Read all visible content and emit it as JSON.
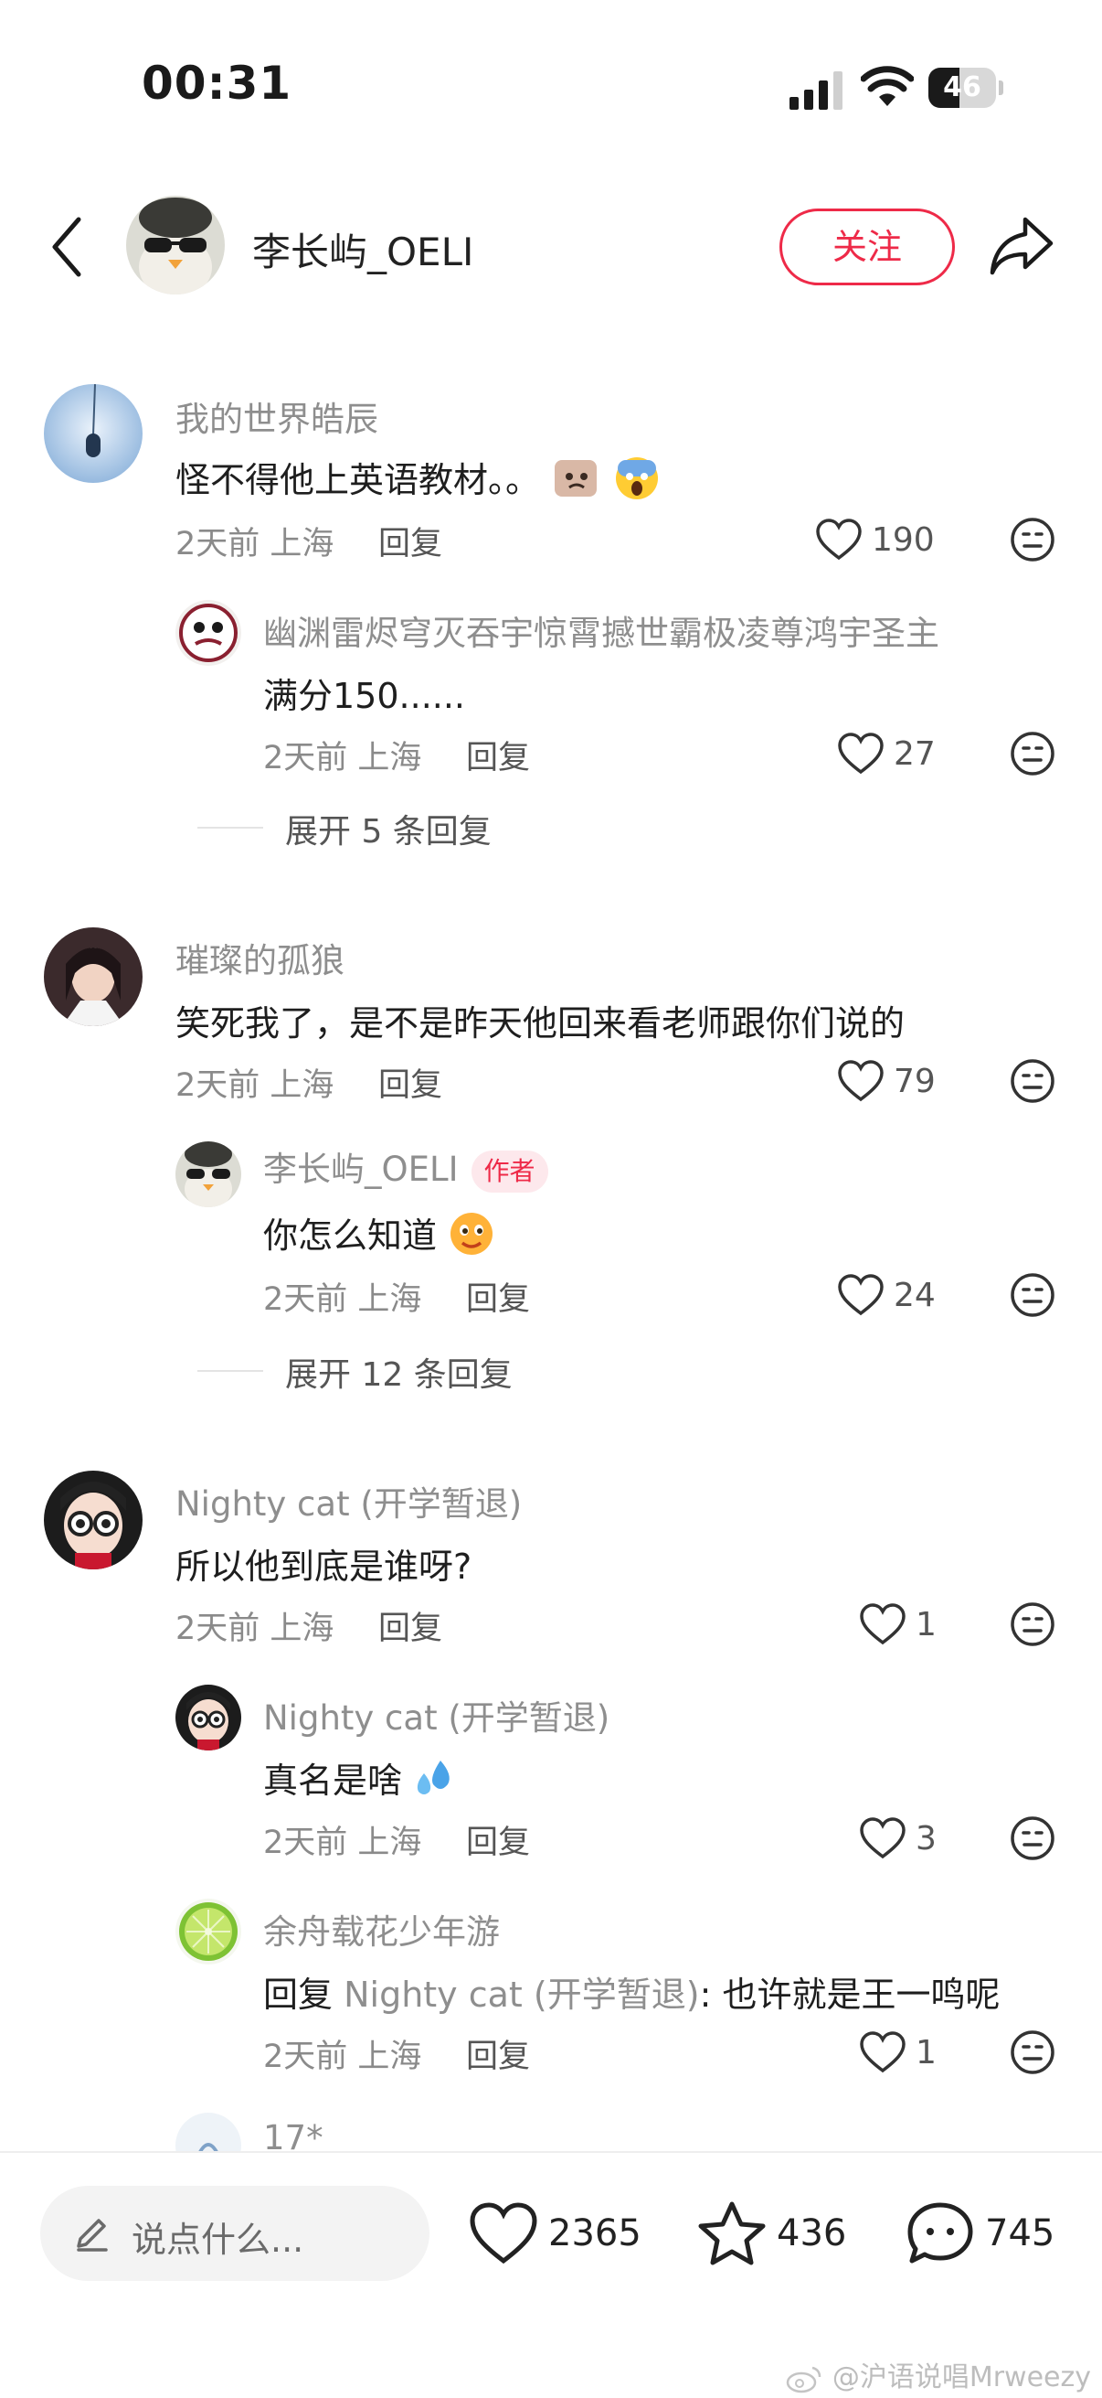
{
  "status_bar": {
    "time": "00:31",
    "battery": "46",
    "battery_level_percent": 46
  },
  "header": {
    "username": "李长屿_OELI",
    "follow_label": "关注"
  },
  "comments": [
    {
      "name": "我的世界皓辰",
      "text": "怪不得他上英语教材。。",
      "time": "2天前",
      "location": "上海",
      "reply_label": "回复",
      "likes": "190",
      "replies": [
        {
          "name": "幽渊雷烬穹灭吞宇惊霄撼世霸极凌尊鸿宇圣主",
          "text": "满分150......",
          "time": "2天前",
          "location": "上海",
          "reply_label": "回复",
          "likes": "27"
        }
      ],
      "expand_label": "展开 5 条回复"
    },
    {
      "name": "璀璨的孤狼",
      "text": "笑死我了，是不是昨天他回来看老师跟你们说的",
      "time": "2天前",
      "location": "上海",
      "reply_label": "回复",
      "likes": "79",
      "replies": [
        {
          "name": "李长屿_OELI",
          "badge": "作者",
          "text": "你怎么知道",
          "time": "2天前",
          "location": "上海",
          "reply_label": "回复",
          "likes": "24"
        }
      ],
      "expand_label": "展开 12 条回复"
    },
    {
      "name": "Nighty cat (开学暂退)",
      "text": "所以他到底是谁呀?",
      "time": "2天前",
      "location": "上海",
      "reply_label": "回复",
      "likes": "1",
      "replies": [
        {
          "name": "Nighty cat (开学暂退)",
          "text": "真名是啥",
          "time": "2天前",
          "location": "上海",
          "reply_label": "回复",
          "likes": "3"
        },
        {
          "name": "余舟载花少年游",
          "text_prefix": "回复 ",
          "reply_to": "Nighty cat (开学暂退)",
          "text": ": 也许就是王一鸣呢",
          "time": "2天前",
          "location": "上海",
          "reply_label": "回复",
          "likes": "1"
        },
        {
          "name": "17*"
        }
      ]
    }
  ],
  "bottom_bar": {
    "input_placeholder": "说点什么...",
    "likes": "2365",
    "favorites": "436",
    "comments": "745",
    "watermark": "@沪语说唱Mrweezy"
  },
  "colors": {
    "accent": "#ee2a48",
    "muted_text": "#8e8e8e"
  },
  "icons": [
    "back-icon",
    "share-icon",
    "heart-icon",
    "neutral-face-icon",
    "star-icon",
    "comment-bubble-icon",
    "pencil-icon",
    "weibo-icon"
  ]
}
